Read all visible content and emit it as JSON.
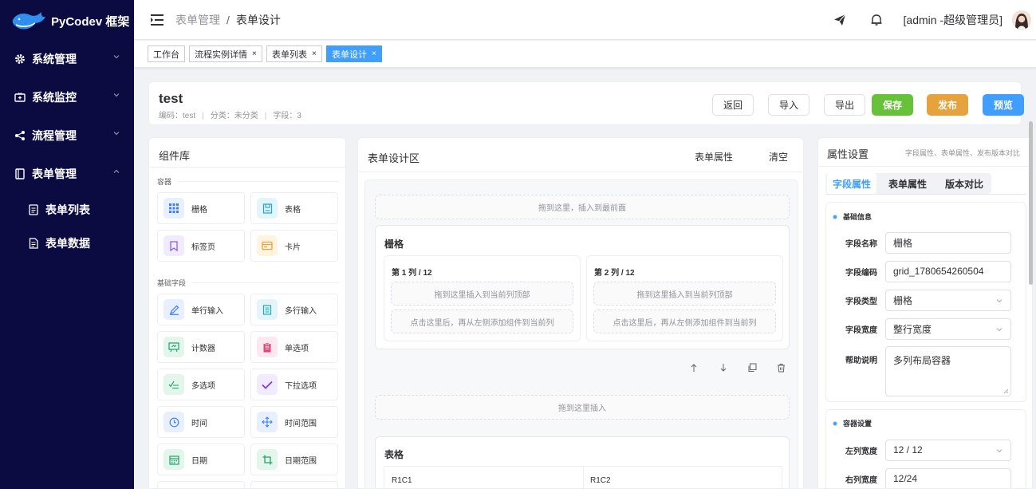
{
  "app": {
    "logo_text": "PyCodev 框架"
  },
  "sidebar": {
    "items": [
      {
        "label": "系统管理",
        "icon": "gear-icon"
      },
      {
        "label": "系统监控",
        "icon": "monitor-icon"
      },
      {
        "label": "流程管理",
        "icon": "share-icon"
      },
      {
        "label": "表单管理",
        "icon": "form-icon"
      }
    ],
    "sub_items": [
      {
        "label": "表单列表",
        "icon": "document-icon"
      },
      {
        "label": "表单数据",
        "icon": "document-icon"
      }
    ]
  },
  "header": {
    "breadcrumb": [
      "表单管理",
      "表单设计"
    ],
    "breadcrumb_sep": "/",
    "user_label": "[admin -超级管理员]"
  },
  "tabs": [
    {
      "label": "工作台"
    },
    {
      "label": "流程实例详情",
      "close": "×"
    },
    {
      "label": "表单列表",
      "close": "×"
    },
    {
      "label": "表单设计",
      "close": "×"
    }
  ],
  "form_header": {
    "title": "test",
    "code_text": "编码：test",
    "category_text": "分类：未分类",
    "fields_text": "字段：3",
    "divider": "|",
    "buttons": {
      "back": "返回",
      "import": "导入",
      "export": "导出",
      "save": "保存",
      "publish": "发布",
      "preview": "预览"
    }
  },
  "library": {
    "title": "组件库",
    "container_section": "容器",
    "basic_section": "基础字段",
    "containers": [
      {
        "label": "栅格",
        "icon": "grid-icon",
        "color": "#3d7eff",
        "bg": "#e8f0ff"
      },
      {
        "label": "表格",
        "icon": "table-icon",
        "color": "#1ea7c9",
        "bg": "#e3f5fa"
      },
      {
        "label": "标签页",
        "icon": "bookmark-icon",
        "color": "#8b5cf6",
        "bg": "#f1ebff"
      },
      {
        "label": "卡片",
        "icon": "card-icon",
        "color": "#e6a23c",
        "bg": "#fff4e0"
      }
    ],
    "basic": [
      {
        "label": "单行输入",
        "icon": "pencil-icon",
        "color": "#3d7eff",
        "bg": "#e8f0ff"
      },
      {
        "label": "多行输入",
        "icon": "textarea-icon",
        "color": "#1ea7c9",
        "bg": "#e3f5fa"
      },
      {
        "label": "计数器",
        "icon": "counter-icon",
        "color": "#22a06b",
        "bg": "#e3f6ec"
      },
      {
        "label": "单选项",
        "icon": "clipboard-icon",
        "color": "#e0457b",
        "bg": "#fde8ef"
      },
      {
        "label": "多选项",
        "icon": "checklist-icon",
        "color": "#22a06b",
        "bg": "#e3f6ec"
      },
      {
        "label": "下拉选项",
        "icon": "check-icon",
        "color": "#7c3aed",
        "bg": "#f1ebff"
      },
      {
        "label": "时间",
        "icon": "clock-icon",
        "color": "#3d7eff",
        "bg": "#e8f0ff"
      },
      {
        "label": "时间范围",
        "icon": "arrows-icon",
        "color": "#3d7eff",
        "bg": "#e8f0ff"
      },
      {
        "label": "日期",
        "icon": "calendar-icon",
        "color": "#22a06b",
        "bg": "#e3f6ec"
      },
      {
        "label": "日期范围",
        "icon": "crop-icon",
        "color": "#22a06b",
        "bg": "#e3f6ec"
      }
    ]
  },
  "designer": {
    "title": "表单设计区",
    "form_props_link": "表单属性",
    "clear_link": "清空",
    "drop_top": "拖到这里，插入到最前面",
    "grid_title": "栅格",
    "col1_title": "第 1 列 / 12",
    "col2_title": "第 2 列 / 12",
    "col_drop_top": "拖到这里插入到当前列顶部",
    "col_drop_add": "点击这里后，再从左侧添加组件到当前列",
    "drop_insert": "拖到这里插入",
    "table_title": "表格",
    "table_cells": [
      "R1C1",
      "R1C2"
    ]
  },
  "props": {
    "title": "属性设置",
    "subtitle": "字段属性、表单属性、发布版本对比",
    "tabs": [
      "字段属性",
      "表单属性",
      "版本对比"
    ],
    "basic_section": "基础信息",
    "fields": [
      {
        "label": "字段名称",
        "value": "栅格",
        "dropdown": false
      },
      {
        "label": "字段编码",
        "value": "grid_1780654260504",
        "dropdown": false
      },
      {
        "label": "字段类型",
        "value": "栅格",
        "dropdown": true
      },
      {
        "label": "字段宽度",
        "value": "整行宽度",
        "dropdown": true
      }
    ],
    "help_label": "帮助说明",
    "help_value": "多列布局容器",
    "container_section": "容器设置",
    "container_fields": [
      {
        "label": "左列宽度",
        "value": "12 / 12",
        "dropdown": true
      },
      {
        "label": "右列宽度",
        "value": "12/24",
        "dropdown": false
      }
    ]
  },
  "colors": {
    "primary": "#409eff",
    "sidebar_bg": "#0b0b42",
    "save": "#67c23a",
    "publish": "#e6a23c"
  }
}
